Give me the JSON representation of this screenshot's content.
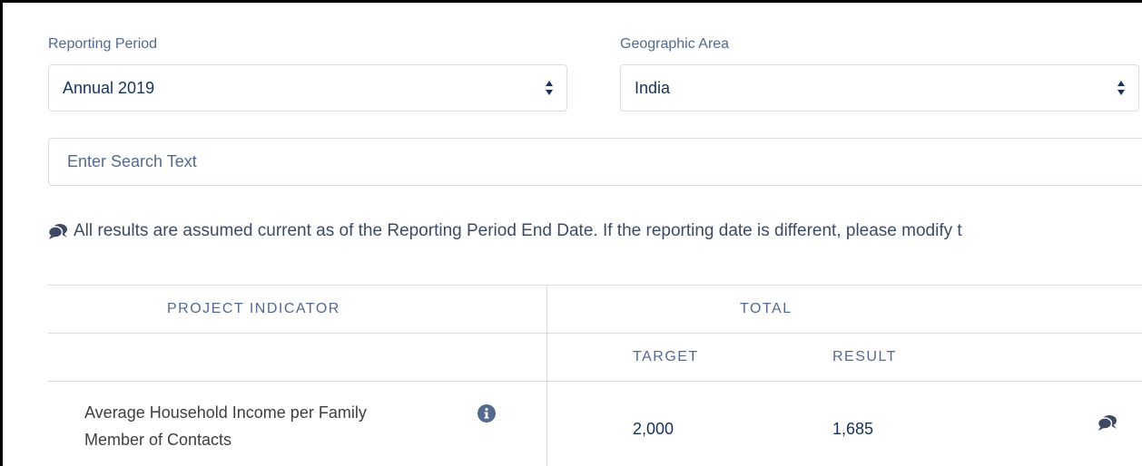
{
  "filters": {
    "reporting_period_label": "Reporting Period",
    "reporting_period_value": "Annual 2019",
    "geographic_area_label": "Geographic Area",
    "geographic_area_value": "India"
  },
  "search": {
    "placeholder": "Enter Search Text"
  },
  "notice": {
    "text": "All results are assumed current as of the Reporting Period End Date. If the reporting date is different, please modify t"
  },
  "table": {
    "headers": {
      "indicator": "PROJECT INDICATOR",
      "total": "TOTAL",
      "target": "TARGET",
      "result": "RESULT"
    },
    "rows": [
      {
        "indicator_line1": "Average Household Income per Family",
        "indicator_line2": "Member of Contacts",
        "target": "2,000",
        "result": "1,685"
      }
    ]
  },
  "icons": {
    "info": "info-icon",
    "comment": "comment-bubbles-icon"
  },
  "colors": {
    "label": "#54698d",
    "text": "#16325c",
    "border": "#d8dde6",
    "icon": "#3e4a64"
  }
}
